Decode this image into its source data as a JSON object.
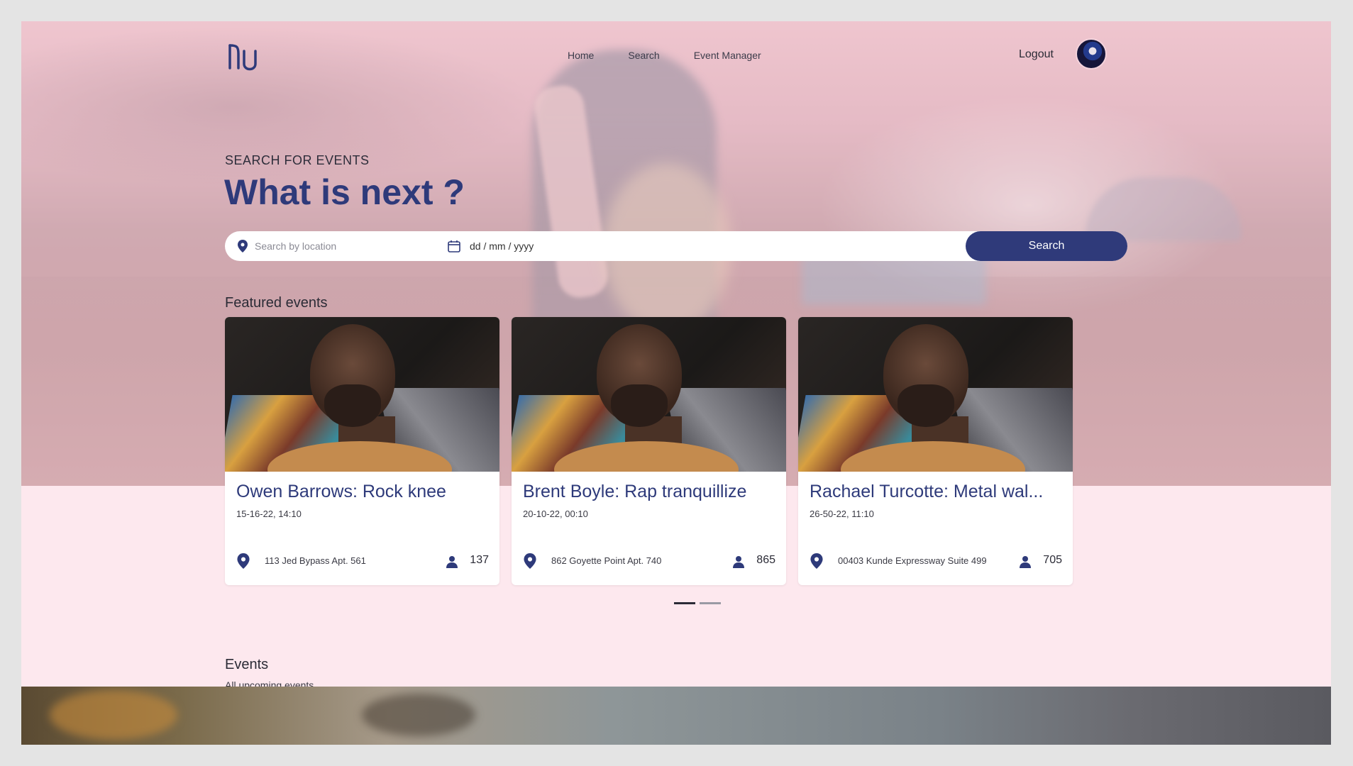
{
  "nav": {
    "logo_icon": "nu-logo-icon",
    "links": [
      {
        "label": "Home"
      },
      {
        "label": "Search"
      },
      {
        "label": "Event Manager"
      }
    ],
    "logout_label": "Logout",
    "avatar_icon": "user-avatar"
  },
  "hero": {
    "kicker": "SEARCH FOR EVENTS",
    "headline": "What is next ?"
  },
  "search": {
    "location_placeholder": "Search by location",
    "location_icon": "map-pin-icon",
    "date_value": "dd / mm / yyyy",
    "date_icon": "calendar-icon",
    "button_label": "Search"
  },
  "featured": {
    "title": "Featured events",
    "cards": [
      {
        "title": "Owen Barrows: Rock knee",
        "date": "15-16-22, 14:10",
        "address": "113 Jed Bypass Apt. 561",
        "attendees": "137"
      },
      {
        "title": "Brent Boyle: Rap tranquillize",
        "date": "20-10-22, 00:10",
        "address": "862 Goyette Point Apt. 740",
        "attendees": "865"
      },
      {
        "title": "Rachael Turcotte: Metal wal...",
        "date": "26-50-22, 11:10",
        "address": "00403 Kunde Expressway Suite 499",
        "attendees": "705"
      }
    ],
    "carousel_pages": 2,
    "carousel_active": 1
  },
  "events": {
    "title": "Events",
    "subtitle": "All upcoming events"
  },
  "colors": {
    "accent": "#2f3a7a",
    "background": "#fde8ee",
    "frame": "#e4e4e4"
  }
}
